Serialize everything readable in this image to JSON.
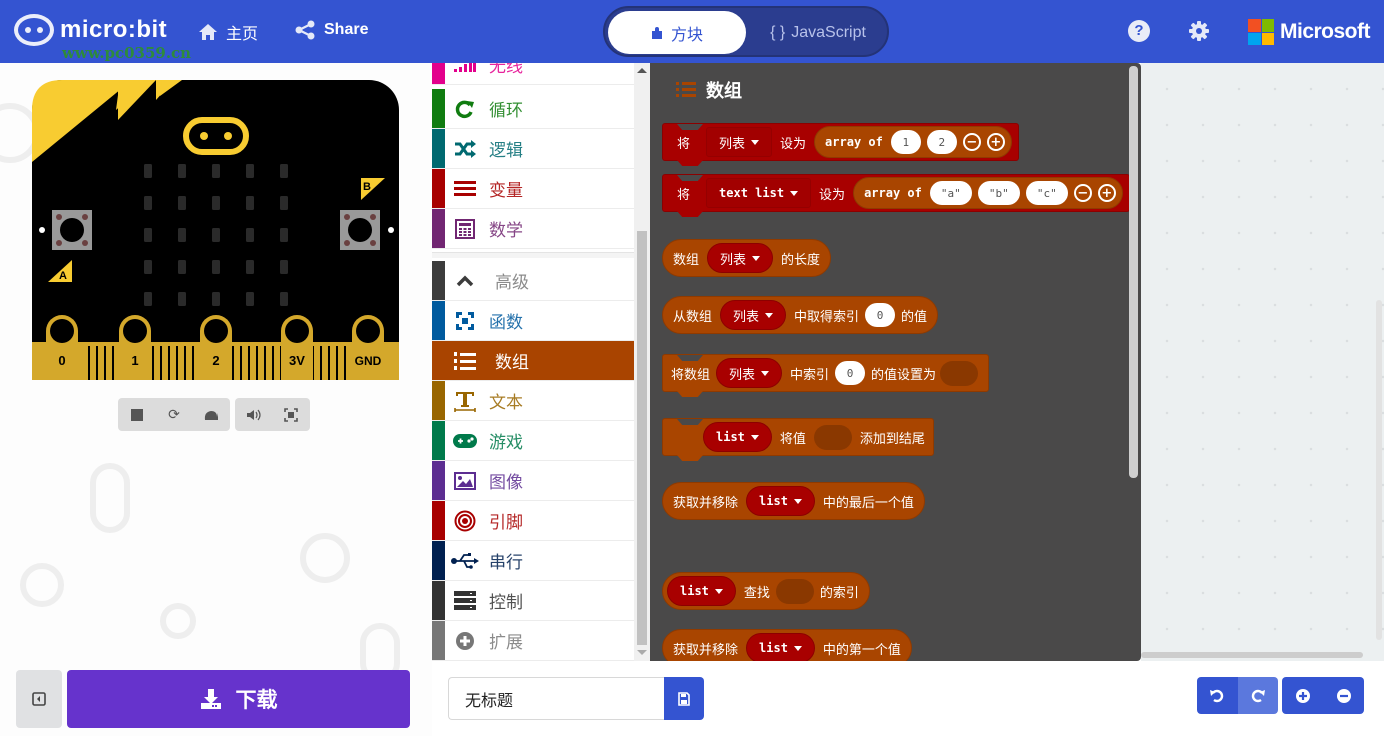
{
  "header": {
    "logo_text": "micro:bit",
    "watermark_text": "www.pc0359.cn",
    "nav": [
      {
        "icon": "home-icon",
        "label": "主页"
      },
      {
        "icon": "share-icon",
        "label": "Share"
      }
    ],
    "editor_toggle": {
      "blocks_label": "方块",
      "javascript_label": "JavaScript",
      "javascript_icon_text": "{ }",
      "active": "blocks"
    },
    "help_icon_text": "?",
    "brand": "Microsoft"
  },
  "simulator": {
    "pins": [
      "0",
      "1",
      "2",
      "3V",
      "GND"
    ],
    "button_a": "A",
    "button_b": "B",
    "led_rows": 5,
    "led_cols": 5,
    "controls": [
      {
        "icon": "stop-icon",
        "label": "stop"
      },
      {
        "icon": "restart-icon",
        "label": "restart"
      },
      {
        "icon": "slow-mo-icon",
        "label": "slow-mo"
      },
      {
        "icon": "mute-icon",
        "label": "mute audio"
      },
      {
        "icon": "fullscreen-icon",
        "label": "fullscreen"
      }
    ]
  },
  "toolbox": {
    "items": [
      {
        "label": "无线",
        "icon": "radio-signal-icon",
        "color": "#e3008c"
      },
      {
        "label": "循环",
        "icon": "loop-icon",
        "color": "#107c10"
      },
      {
        "label": "逻辑",
        "icon": "shuffle-icon",
        "color": "#006970"
      },
      {
        "label": "变量",
        "icon": "variables-icon",
        "color": "#a80000"
      },
      {
        "label": "数学",
        "icon": "calculator-icon",
        "color": "#712672"
      },
      {
        "label": "高级",
        "icon": "chevron-up-icon",
        "color": "#3c3c3c"
      },
      {
        "label": "函数",
        "icon": "functions-icon",
        "color": "#005a9e"
      },
      {
        "label": "数组",
        "icon": "list-numbered-icon",
        "color": "#a94400",
        "selected": true
      },
      {
        "label": "文本",
        "icon": "text-icon",
        "color": "#996600"
      },
      {
        "label": "游戏",
        "icon": "gamepad-icon",
        "color": "#007a4b"
      },
      {
        "label": "图像",
        "icon": "image-icon",
        "color": "#5c2d91"
      },
      {
        "label": "引脚",
        "icon": "pins-target-icon",
        "color": "#a80000"
      },
      {
        "label": "串行",
        "icon": "usb-icon",
        "color": "#002050"
      },
      {
        "label": "控制",
        "icon": "server-icon",
        "color": "#333333"
      },
      {
        "label": "扩展",
        "icon": "add-circle-icon",
        "color": "#777777"
      }
    ]
  },
  "flyout": {
    "title": "数组",
    "blocks": {
      "set_list": {
        "prefix": "将",
        "var": "列表",
        "mid": "设为",
        "array_kw": "array of",
        "values": [
          "1",
          "2"
        ]
      },
      "set_text_list": {
        "prefix": "将",
        "var": "text list",
        "mid": "设为",
        "array_kw": "array of",
        "values": [
          "\"a\"",
          "\"b\"",
          "\"c\""
        ]
      },
      "length": {
        "prefix": "数组",
        "var": "列表",
        "suffix": "的长度"
      },
      "get_index": {
        "prefix": "从数组",
        "var": "列表",
        "mid": "中取得索引",
        "index": "0",
        "suffix": "的值"
      },
      "set_index": {
        "prefix": "将数组",
        "var": "列表",
        "mid": "中索引",
        "index": "0",
        "suffix": "的值设置为"
      },
      "push": {
        "var": "list",
        "mid": "将值",
        "suffix": "添加到结尾"
      },
      "pop": {
        "prefix": "获取并移除",
        "var": "list",
        "suffix": "中的最后一个值"
      },
      "index_of": {
        "var": "list",
        "mid": "查找",
        "suffix": "的索引"
      },
      "shift": {
        "prefix": "获取并移除",
        "var": "list",
        "suffix": "中的第一个值"
      }
    }
  },
  "bottom": {
    "download_label": "下载",
    "project_name": "无标题",
    "project_placeholder": "无标题"
  },
  "colors": {
    "header": "#3454d1",
    "download": "#6633cc",
    "arrays": "#a94400",
    "variables": "#a80000",
    "flyout_bg": "#4a4949"
  }
}
